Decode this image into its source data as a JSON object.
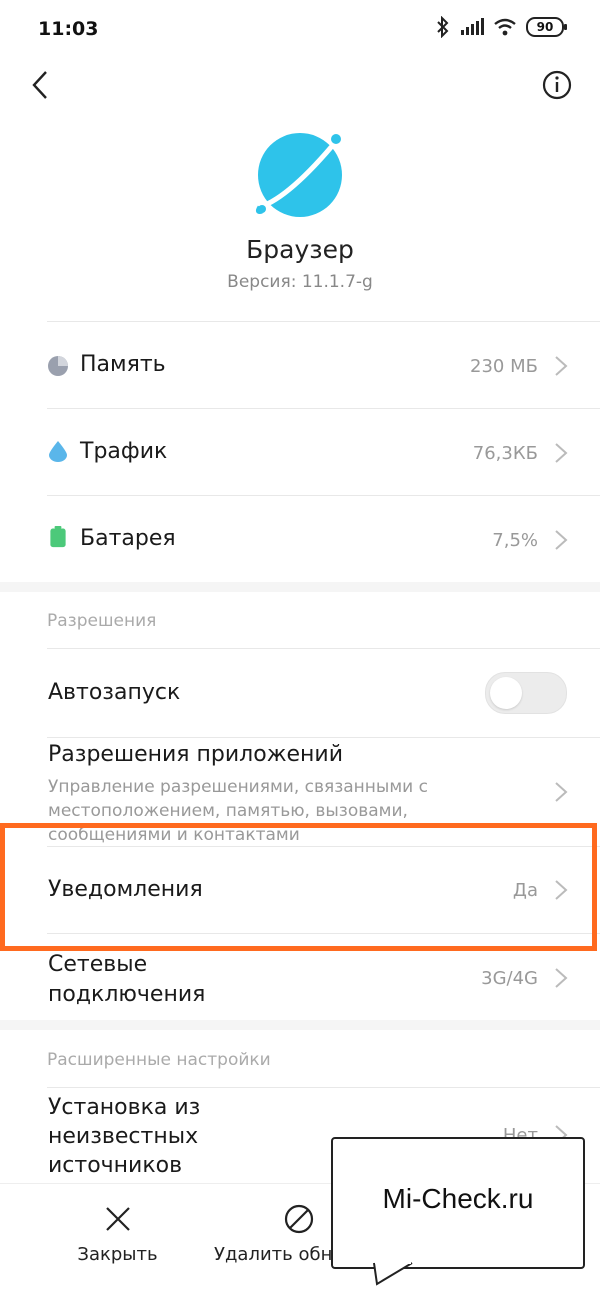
{
  "status_bar": {
    "time": "11:03",
    "battery": "90"
  },
  "app": {
    "name": "Браузер",
    "version": "Версия: 11.1.7-g",
    "icon_color": "#2ec3ea"
  },
  "usage": [
    {
      "label": "Память",
      "value": "230 МБ",
      "icon": "pie-chart-icon"
    },
    {
      "label": "Трафик",
      "value": "76,3КБ",
      "icon": "water-drop-icon"
    },
    {
      "label": "Батарея",
      "value": "7,5%",
      "icon": "battery-icon"
    }
  ],
  "permissions": {
    "section_title": "Разрешения",
    "autostart": {
      "label": "Автозапуск",
      "enabled": false
    },
    "app_permissions": {
      "label": "Разрешения приложений",
      "description": "Управление разрешениями, связанными с местоположением, памятью, вызовами, сообщениями и контактами"
    },
    "notifications": {
      "label": "Уведомления",
      "value": "Да"
    },
    "network": {
      "label_line1": "Сетевые",
      "label_line2": "подключения",
      "value": "3G/4G"
    }
  },
  "advanced": {
    "section_title": "Расширенные настройки",
    "unknown_sources": {
      "line1": "Установка из",
      "line2": "неизвестных",
      "line3": "источников",
      "value": "Нет"
    }
  },
  "bottom_bar": {
    "close_label": "Закрыть",
    "uninstall_updates_label": "Удалить обно"
  },
  "callout": {
    "text": "Mi-Check.ru"
  },
  "colors": {
    "highlight": "#ff6a1f",
    "accent": "#2ec3ea"
  }
}
